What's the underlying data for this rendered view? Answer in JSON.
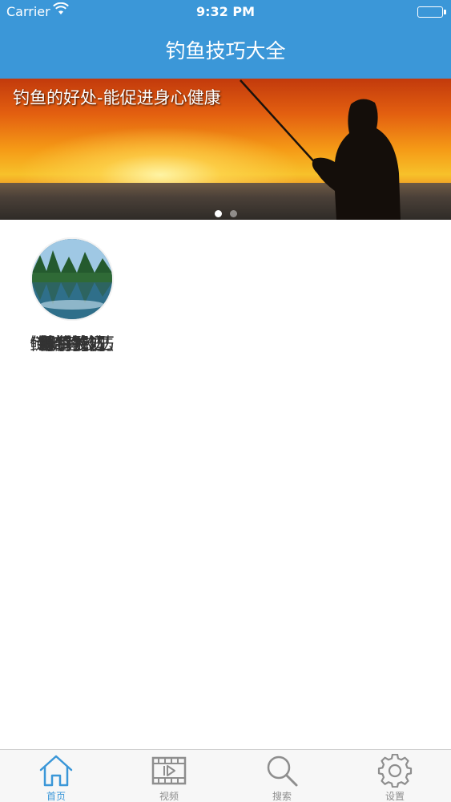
{
  "status_bar": {
    "carrier": "Carrier",
    "time": "9:32 PM"
  },
  "nav": {
    "title": "钓鱼技巧大全"
  },
  "banner": {
    "caption": "钓鱼的好处-能促进身心健康",
    "page_count": 2,
    "active_page": 1
  },
  "categories": [
    {
      "label": "新手入门",
      "icon": "beginner-thumbnail"
    },
    {
      "label": "鱼饵配方",
      "icon": "bait-thumbnail"
    },
    {
      "label": "传统钓技巧",
      "icon": "traditional-thumbnail"
    },
    {
      "label": "台钓技巧",
      "icon": "platform-thumbnail"
    },
    {
      "label": "野钓技巧",
      "icon": "wild-thumbnail"
    },
    {
      "label": "鲫鱼钓法",
      "icon": "crucian-thumbnail"
    },
    {
      "label": "鲢鳙鱼钓法",
      "icon": "silver-carp-thumbnail"
    },
    {
      "label": "草鱼钓法",
      "icon": "grass-carp-thumbnail"
    },
    {
      "label": "鲤鱼钓法",
      "icon": "carp-thumbnail"
    }
  ],
  "tabs": [
    {
      "label": "首页",
      "icon": "home-icon",
      "active": true
    },
    {
      "label": "视频",
      "icon": "film-icon",
      "active": false
    },
    {
      "label": "搜索",
      "icon": "search-icon",
      "active": false
    },
    {
      "label": "设置",
      "icon": "gear-icon",
      "active": false
    }
  ],
  "colors": {
    "accent": "#3b97d8",
    "text": "#333333",
    "tab_inactive": "#8e8e8e"
  }
}
